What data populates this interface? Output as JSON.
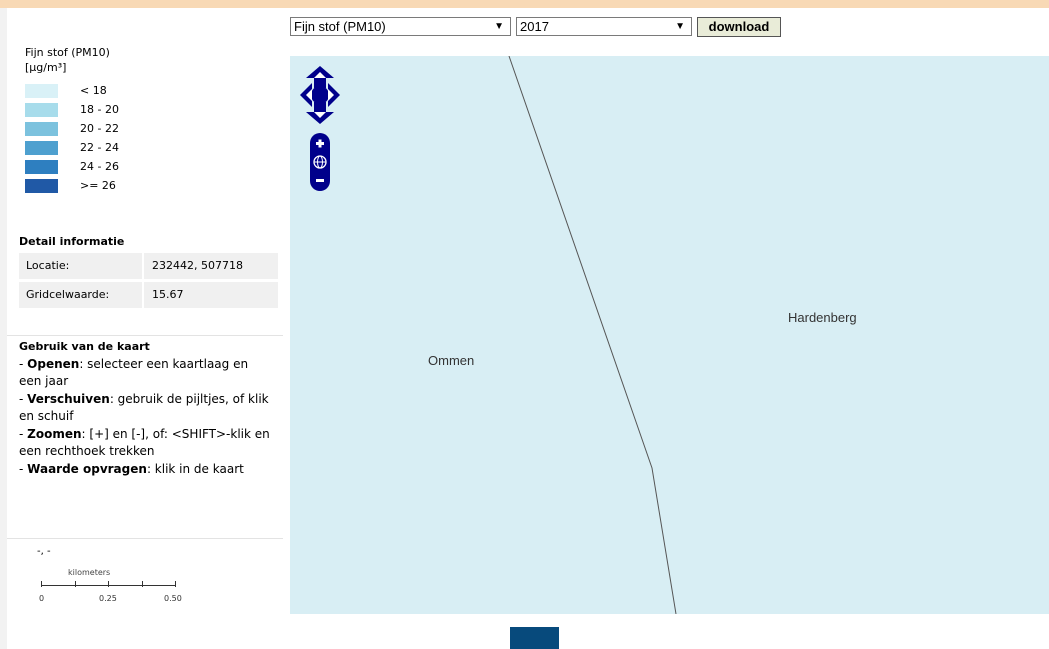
{
  "controls": {
    "layer_select": "Fijn stof (PM10)",
    "year_select": "2017",
    "download_label": "download"
  },
  "legend": {
    "title": "Fijn stof (PM10)",
    "unit": "[µg/m³]",
    "items": [
      {
        "label": "< 18",
        "color": "#d9f1f7"
      },
      {
        "label": "18 - 20",
        "color": "#a7dceb"
      },
      {
        "label": "20 - 22",
        "color": "#7cc2de"
      },
      {
        "label": "22 - 24",
        "color": "#4ea0cf"
      },
      {
        "label": "24 - 26",
        "color": "#2e7fc0"
      },
      {
        "label": ">= 26",
        "color": "#2059a6"
      }
    ]
  },
  "detail": {
    "title": "Detail informatie",
    "rows": [
      {
        "key": "Locatie:",
        "value": "232442, 507718"
      },
      {
        "key": "Gridcelwaarde:",
        "value": "15.67"
      }
    ]
  },
  "usage": {
    "title": "Gebruik van de kaart",
    "lines": [
      {
        "bold": "Openen",
        "text": ": selecteer een kaartlaag en een jaar"
      },
      {
        "bold": "Verschuiven",
        "text": ": gebruik de pijltjes, of klik en schuif"
      },
      {
        "bold": "Zoomen",
        "text": ": [+] en [-], of: <SHIFT>-klik en een rechthoek trekken"
      },
      {
        "bold": "Waarde opvragen",
        "text": ": klik in de kaart"
      }
    ],
    "zoom_plus": "[+]",
    "zoom_minus": "[-]"
  },
  "coords": "-, -",
  "scale": {
    "unit": "kilometers",
    "labels": [
      "0",
      "0.25",
      "0.50"
    ]
  },
  "map": {
    "background": "#d8eef4",
    "places": [
      "Ommen",
      "Hardenberg"
    ],
    "nav_color": "#00008b"
  }
}
